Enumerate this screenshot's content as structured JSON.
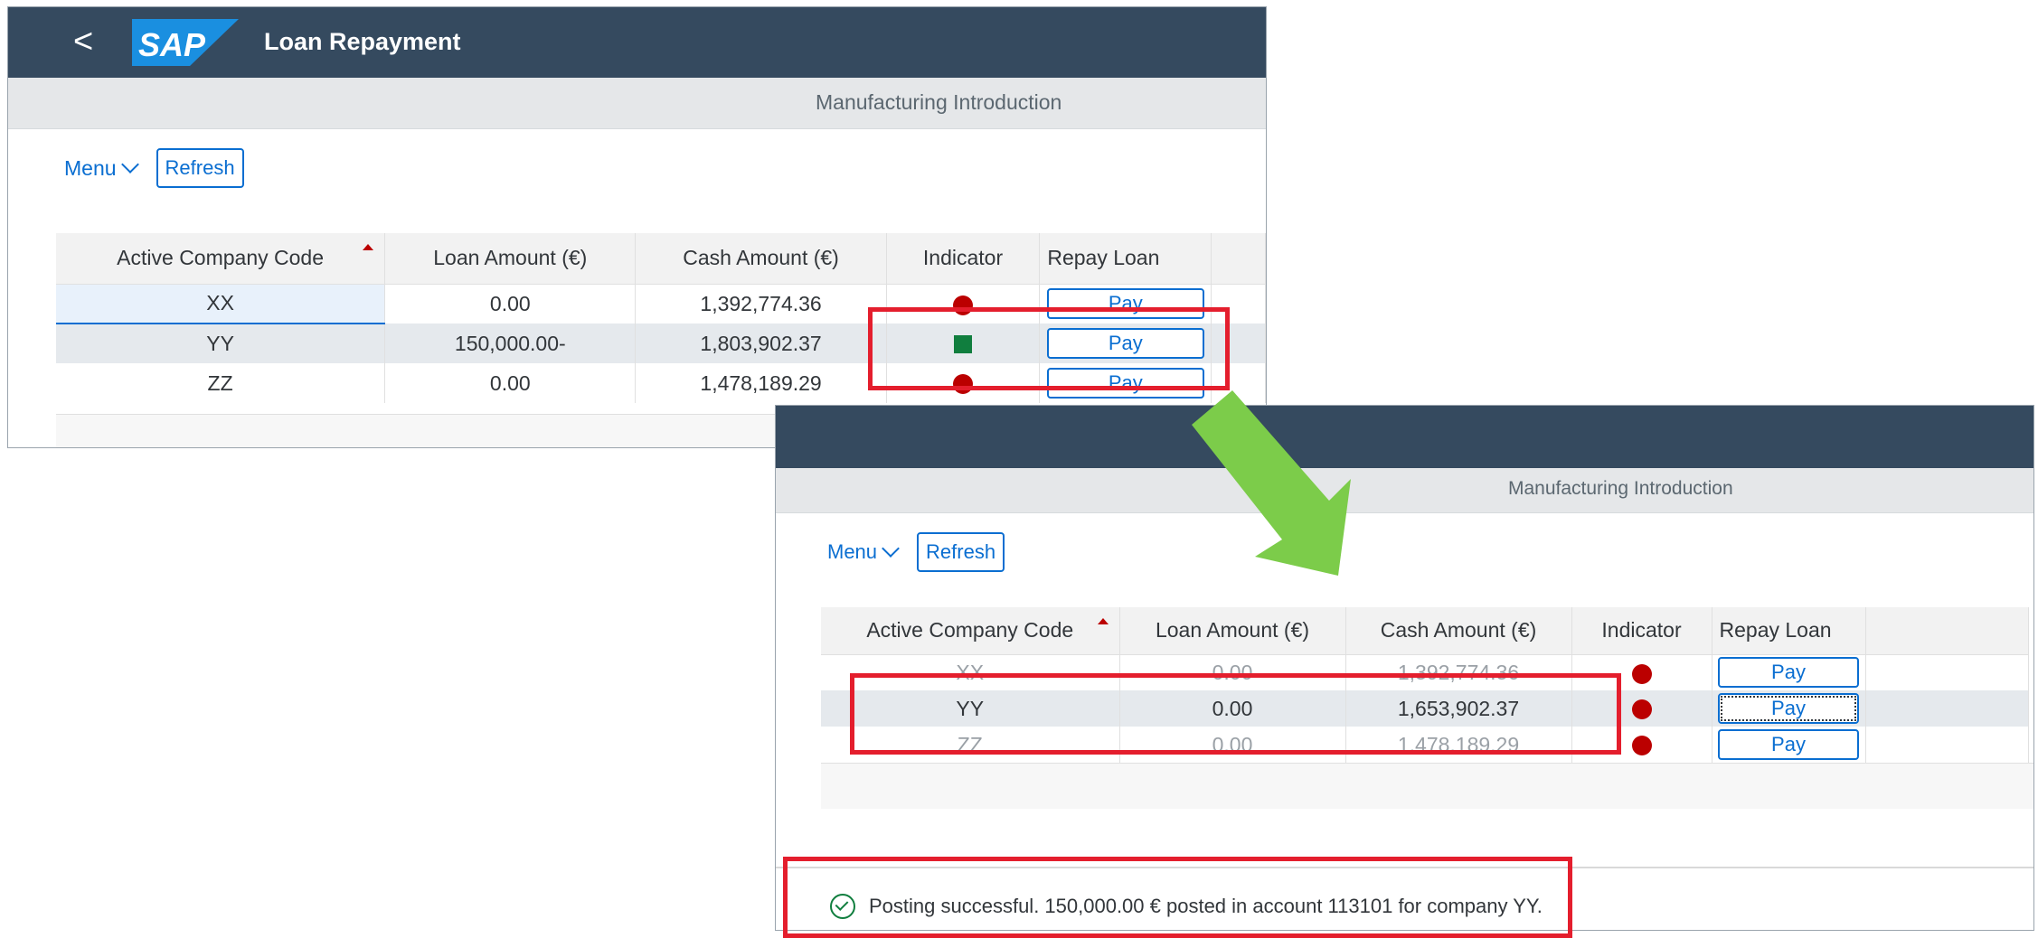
{
  "window1": {
    "back_label": "<",
    "logo_text": "SAP",
    "title": "Loan Repayment",
    "subheader": "Manufacturing Introduction",
    "menu_label": "Menu",
    "refresh_label": "Refresh",
    "columns": [
      "Active Company Code",
      "Loan Amount (€)",
      "Cash Amount (€)",
      "Indicator",
      "Repay Loan"
    ],
    "rows": [
      {
        "code": "XX",
        "loan": "0.00",
        "cash": "1,392,774.36",
        "indicator": "red-circle",
        "action": "Pay"
      },
      {
        "code": "YY",
        "loan": "150,000.00-",
        "cash": "1,803,902.37",
        "indicator": "green-square",
        "action": "Pay"
      },
      {
        "code": "ZZ",
        "loan": "0.00",
        "cash": "1,478,189.29",
        "indicator": "red-circle",
        "action": "Pay"
      }
    ]
  },
  "window2": {
    "subheader": "Manufacturing Introduction",
    "menu_label": "Menu",
    "refresh_label": "Refresh",
    "columns": [
      "Active Company Code",
      "Loan Amount (€)",
      "Cash Amount (€)",
      "Indicator",
      "Repay Loan"
    ],
    "rows": [
      {
        "code": "XX",
        "loan": "0.00",
        "cash": "1,392,774.36",
        "indicator": "red-circle",
        "action": "Pay"
      },
      {
        "code": "YY",
        "loan": "0.00",
        "cash": "1,653,902.37",
        "indicator": "red-circle",
        "action": "Pay"
      },
      {
        "code": "ZZ",
        "loan": "0.00",
        "cash": "1,478,189.29",
        "indicator": "red-circle",
        "action": "Pay"
      }
    ],
    "message": "Posting successful. 150,000.00 € posted in account 113101 for company YY."
  },
  "colors": {
    "shell": "#354a5f",
    "accent": "#0a6ed1",
    "error": "#bb0000",
    "success": "#107e3e",
    "highlight": "#e41e2d",
    "arrow": "#7ccc4a"
  }
}
